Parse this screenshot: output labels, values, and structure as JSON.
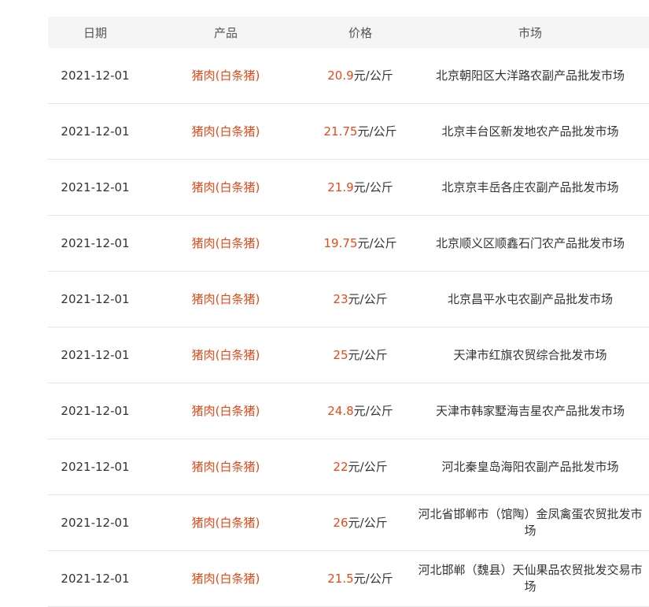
{
  "colors": {
    "accent": "#e64a19",
    "header_bg": "#f5f5f5",
    "text": "#333333",
    "divider": "#e6e6e6"
  },
  "table": {
    "headers": {
      "date": "日期",
      "product": "产品",
      "price": "价格",
      "market": "市场"
    },
    "rows": [
      {
        "date": "2021-12-01",
        "product": "猪肉(白条猪)",
        "price": "20.9",
        "unit": "元/公斤",
        "market": "北京朝阳区大洋路农副产品批发市场"
      },
      {
        "date": "2021-12-01",
        "product": "猪肉(白条猪)",
        "price": "21.75",
        "unit": "元/公斤",
        "market": "北京丰台区新发地农产品批发市场"
      },
      {
        "date": "2021-12-01",
        "product": "猪肉(白条猪)",
        "price": "21.9",
        "unit": "元/公斤",
        "market": "北京京丰岳各庄农副产品批发市场"
      },
      {
        "date": "2021-12-01",
        "product": "猪肉(白条猪)",
        "price": "19.75",
        "unit": "元/公斤",
        "market": "北京顺义区顺鑫石门农产品批发市场"
      },
      {
        "date": "2021-12-01",
        "product": "猪肉(白条猪)",
        "price": "23",
        "unit": "元/公斤",
        "market": "北京昌平水屯农副产品批发市场"
      },
      {
        "date": "2021-12-01",
        "product": "猪肉(白条猪)",
        "price": "25",
        "unit": "元/公斤",
        "market": "天津市红旗农贸综合批发市场"
      },
      {
        "date": "2021-12-01",
        "product": "猪肉(白条猪)",
        "price": "24.8",
        "unit": "元/公斤",
        "market": "天津市韩家墅海吉星农产品批发市场"
      },
      {
        "date": "2021-12-01",
        "product": "猪肉(白条猪)",
        "price": "22",
        "unit": "元/公斤",
        "market": "河北秦皇岛海阳农副产品批发市场"
      },
      {
        "date": "2021-12-01",
        "product": "猪肉(白条猪)",
        "price": "26",
        "unit": "元/公斤",
        "market": "河北省邯郸市（馆陶）金凤禽蛋农贸批发市场"
      },
      {
        "date": "2021-12-01",
        "product": "猪肉(白条猪)",
        "price": "21.5",
        "unit": "元/公斤",
        "market": "河北邯郸（魏县）天仙果品农贸批发交易市场"
      }
    ]
  }
}
